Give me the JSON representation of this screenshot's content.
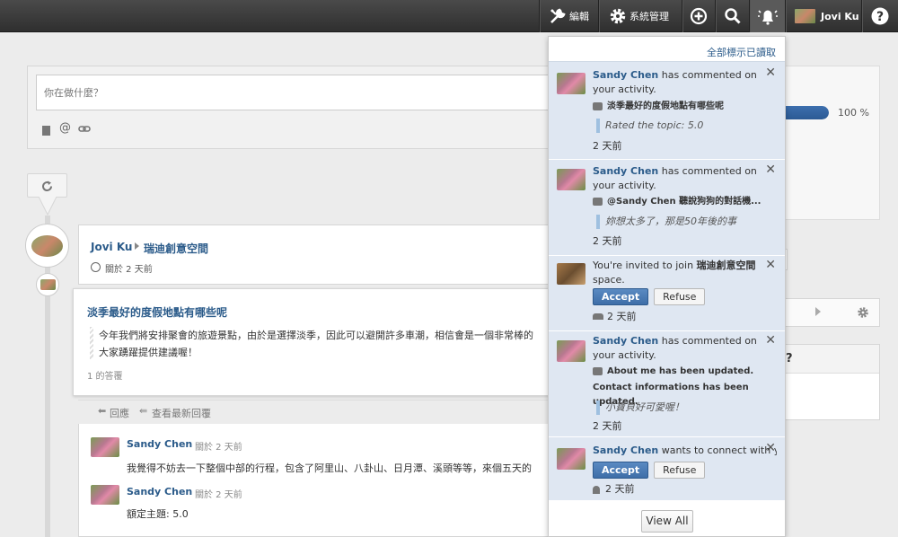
{
  "topbar": {
    "edit_label": "編輯",
    "admin_label": "系統管理",
    "user_name": "Jovi Ku"
  },
  "composer": {
    "placeholder": "你在做什麼？"
  },
  "progress_text": "100 %",
  "progress": 1.0,
  "post": {
    "author": "Jovi Ku",
    "space": "瑞迪創意空間",
    "time": "關於 2 天前",
    "title": "淡季最好的度假地點有哪些呢",
    "body_line1": "今年我們將安排聚會的旅遊景點，由於是選擇淡季，因此可以避開許多車潮，相信會是一個非常棒的",
    "body_line2": "大家踴躍提供建議喔！",
    "answers": "1 的答覆",
    "reply_label": "回應",
    "view_latest_label": "查看最新回覆"
  },
  "comments": [
    {
      "author": "Sandy Chen",
      "time": "關於 2 天前",
      "text": "我覺得不妨去一下整個中部的行程，包含了阿里山、八卦山、日月潭、溪頭等等，來個五天的"
    },
    {
      "author": "Sandy Chen",
      "time": "關於 2 天前",
      "text": "額定主題: 5.0"
    }
  ],
  "right_partial": {
    "question_mark": "?"
  },
  "notifications": {
    "mark_all_read": "全部標示已讀取",
    "view_all": "View All",
    "items": [
      {
        "actor": "Sandy Chen",
        "action": " has commented on your activity.",
        "subject": "淡季最好的度假地點有哪些呢",
        "quote": "Rated the topic: 5.0",
        "time": "2 天前"
      },
      {
        "actor": "Sandy Chen",
        "action": " has commented on your activity.",
        "subject": "@Sandy Chen 聽說狗狗的對話機...",
        "quote": "妳想太多了，那是50年後的事",
        "time": "2 天前"
      },
      {
        "pre": "You're invited to join ",
        "space": "瑞迪創意空間",
        "post": " space.",
        "accept": "Accept",
        "refuse": "Refuse",
        "time": "2 天前"
      },
      {
        "actor": "Sandy Chen",
        "action": " has commented on your activity.",
        "line1": "About me has been updated.",
        "line2": "Contact informations has been updated.",
        "quote": "小寶貝好可愛喔！",
        "time": "2 天前"
      },
      {
        "actor": "Sandy Chen",
        "action": " wants to connect with you",
        "accept": "Accept",
        "refuse": "Refuse",
        "time": "2 天前"
      }
    ]
  }
}
